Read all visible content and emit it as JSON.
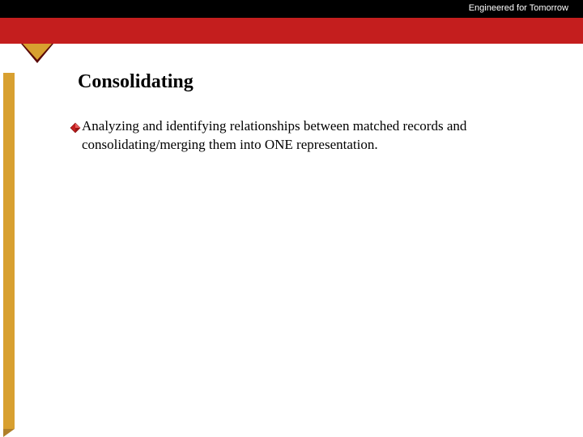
{
  "header": {
    "tagline": "Engineered for Tomorrow"
  },
  "slide": {
    "title": "Consolidating",
    "bullet_text": "Analyzing and identifying relationships between matched records and consolidating/merging them into ONE representation."
  },
  "colors": {
    "red": "#c41e1e",
    "gold": "#d8a030",
    "black": "#000000"
  }
}
